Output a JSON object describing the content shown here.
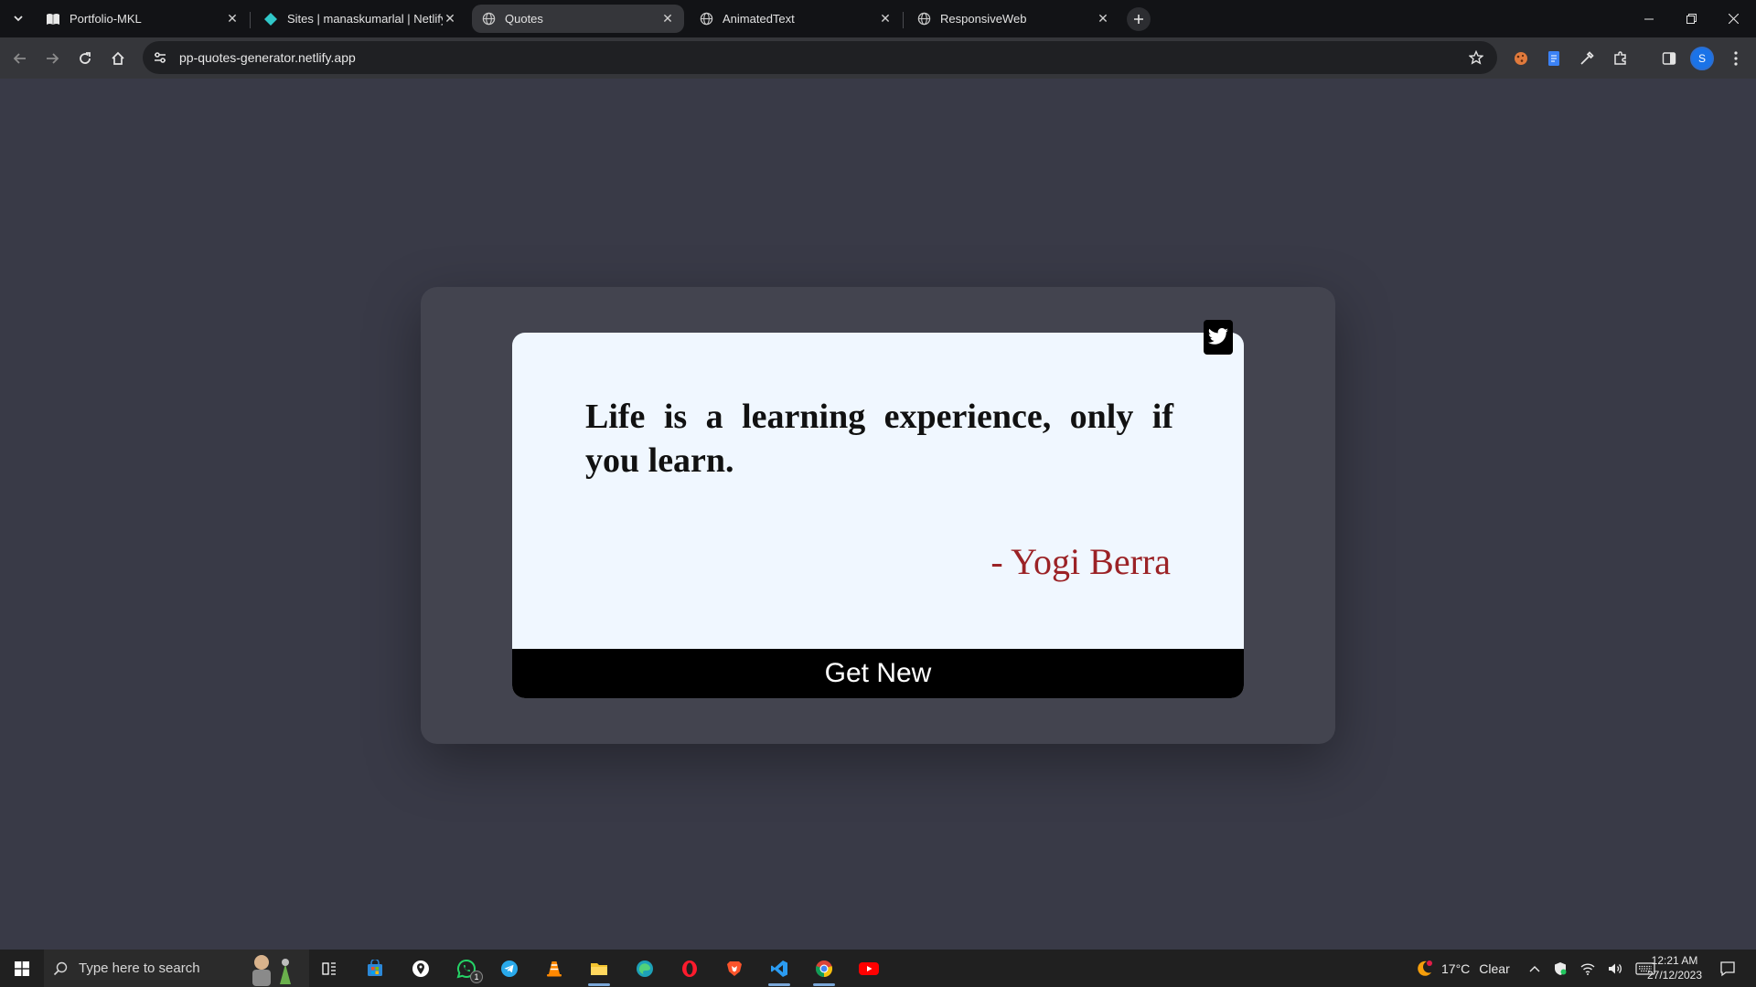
{
  "browser": {
    "tabs": [
      {
        "title": "Portfolio-MKL",
        "icon": "book-icon"
      },
      {
        "title": "Sites | manaskumarlal | Netlify",
        "icon": "netlify-icon"
      },
      {
        "title": "Quotes",
        "icon": "globe-icon",
        "active": true
      },
      {
        "title": "AnimatedText",
        "icon": "globe-icon"
      },
      {
        "title": "ResponsiveWeb",
        "icon": "globe-icon"
      }
    ],
    "url": "pp-quotes-generator.netlify.app",
    "profile_initial": "S"
  },
  "page": {
    "quote": "Life is a learning experience, only if you learn.",
    "author": "- Yogi Berra",
    "button_label": "Get New",
    "colors": {
      "background": "#393a47",
      "card": "#f0f7ff",
      "author": "#9b2226",
      "button": "#000000"
    }
  },
  "taskbar": {
    "search_placeholder": "Type here to search",
    "weather_temp": "17°C",
    "weather_text": "Clear",
    "time": "12:21 AM",
    "date": "27/12/2023",
    "whatsapp_badge": "1"
  }
}
